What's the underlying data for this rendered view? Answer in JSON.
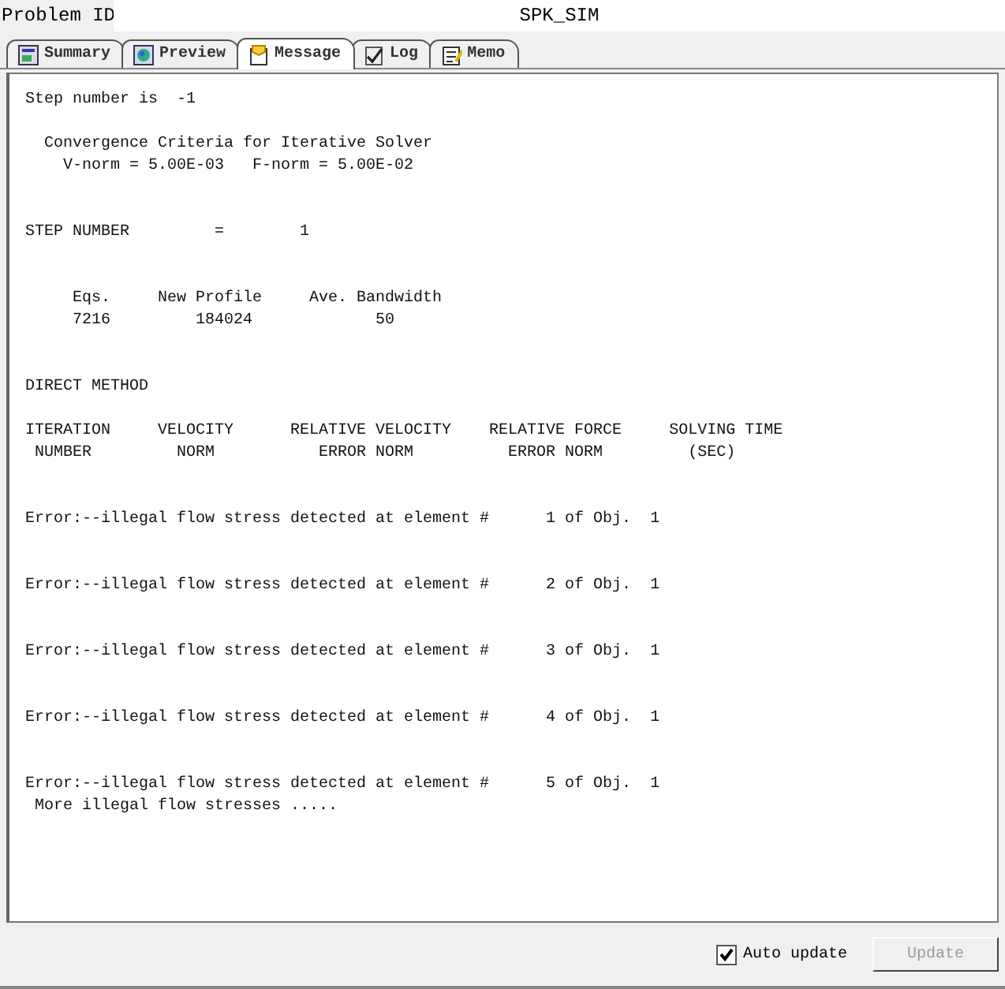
{
  "problem_id": {
    "label": "Problem ID",
    "value": "SPK_SIM"
  },
  "tabs": [
    {
      "label": "Summary",
      "selected": false,
      "kind": "summary"
    },
    {
      "label": "Preview",
      "selected": false,
      "kind": "preview"
    },
    {
      "label": "Message",
      "selected": true,
      "kind": "message"
    },
    {
      "label": "Log",
      "selected": false,
      "kind": "log"
    },
    {
      "label": "Memo",
      "selected": false,
      "kind": "memo"
    }
  ],
  "message_blocks": [
    {
      "lines": [
        "Step number is  -1"
      ]
    },
    {
      "lines": [
        "  Convergence Criteria for Iterative Solver",
        "    V-norm = 5.00E-03   F-norm = 5.00E-02"
      ]
    },
    {
      "lines": [
        "STEP NUMBER         =        1"
      ]
    },
    {
      "lines": [
        "     Eqs.     New Profile     Ave. Bandwidth",
        "     7216         184024             50"
      ]
    },
    {
      "lines": [
        "DIRECT METHOD"
      ]
    },
    {
      "lines": [
        "ITERATION     VELOCITY      RELATIVE VELOCITY    RELATIVE FORCE     SOLVING TIME",
        " NUMBER         NORM           ERROR NORM          ERROR NORM         (SEC)"
      ]
    },
    {
      "lines": [
        "Error:--illegal flow stress detected at element #      1 of Obj.  1"
      ]
    },
    {
      "lines": [
        "Error:--illegal flow stress detected at element #      2 of Obj.  1"
      ]
    },
    {
      "lines": [
        "Error:--illegal flow stress detected at element #      3 of Obj.  1"
      ]
    },
    {
      "lines": [
        "Error:--illegal flow stress detected at element #      4 of Obj.  1"
      ]
    },
    {
      "lines": [
        "Error:--illegal flow stress detected at element #      5 of Obj.  1",
        " More illegal flow stresses ....."
      ]
    }
  ],
  "auto_update": {
    "label": "Auto update",
    "checked": true
  },
  "update_button": {
    "label": "Update",
    "disabled": true
  }
}
